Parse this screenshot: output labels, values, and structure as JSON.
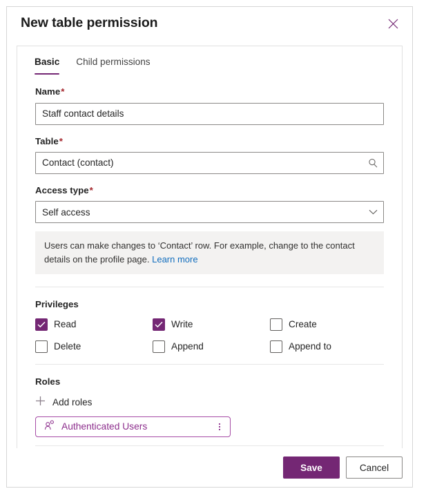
{
  "dialog": {
    "title": "New table permission",
    "close_icon": "close-icon"
  },
  "tabs": [
    {
      "label": "Basic",
      "active": true
    },
    {
      "label": "Child permissions",
      "active": false
    }
  ],
  "fields": {
    "name": {
      "label": "Name",
      "required_marker": "*",
      "value": "Staff contact details",
      "placeholder": ""
    },
    "table": {
      "label": "Table",
      "required_marker": "*",
      "value": "Contact (contact)",
      "placeholder": "",
      "icon": "search-icon"
    },
    "access_type": {
      "label": "Access type",
      "required_marker": "*",
      "value": "Self access",
      "icon": "chevron-down-icon",
      "options": [
        "Self access"
      ]
    }
  },
  "info": {
    "text": "Users can make changes to ‘Contact’ row. For example, change to the contact details on the profile page. ",
    "link_label": "Learn more",
    "link_color": "#0f6cbd",
    "background": "#f3f2f1"
  },
  "privileges": {
    "heading": "Privileges",
    "items": [
      {
        "label": "Read",
        "checked": true
      },
      {
        "label": "Write",
        "checked": true
      },
      {
        "label": "Create",
        "checked": false
      },
      {
        "label": "Delete",
        "checked": false
      },
      {
        "label": "Append",
        "checked": false
      },
      {
        "label": "Append to",
        "checked": false
      }
    ]
  },
  "roles": {
    "heading": "Roles",
    "add_label": "Add roles",
    "add_icon": "plus-icon",
    "items": [
      {
        "label": "Authenticated Users",
        "icon": "person-role-icon",
        "more_icon": "more-vertical-icon"
      }
    ]
  },
  "footer": {
    "save_label": "Save",
    "cancel_label": "Cancel"
  },
  "colors": {
    "accent": "#742774",
    "accent_light": "#8c2d8c",
    "required": "#a4262c",
    "link": "#0f6cbd",
    "info_bg": "#f3f2f1",
    "border": "#8a8886",
    "divider": "#e6e6e6"
  }
}
